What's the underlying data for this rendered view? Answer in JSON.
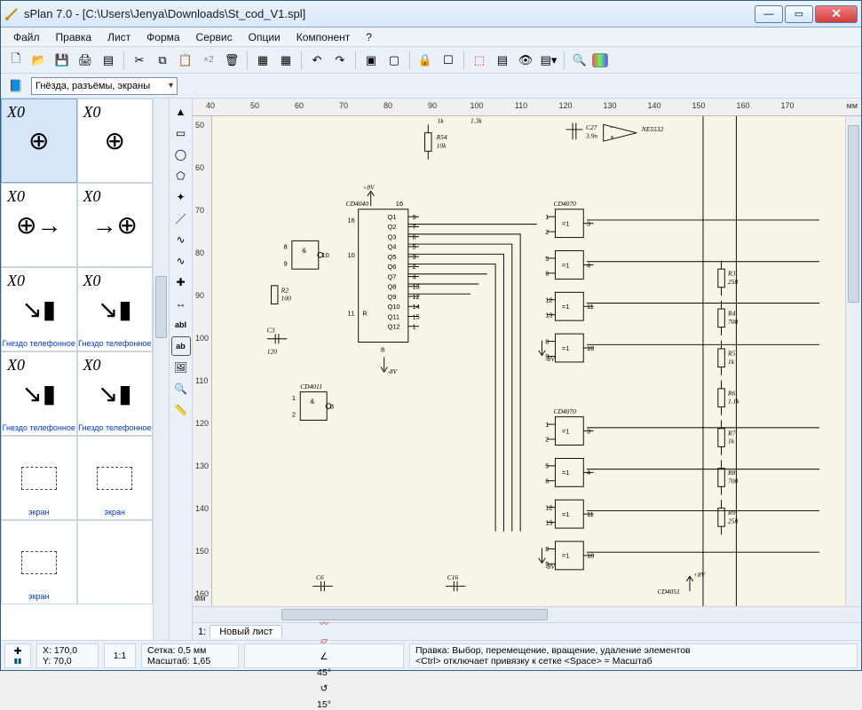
{
  "window": {
    "title": "sPlan 7.0 - [C:\\Users\\Jenya\\Downloads\\St_cod_V1.spl]"
  },
  "menu": [
    "Файл",
    "Правка",
    "Лист",
    "Форма",
    "Сервис",
    "Опции",
    "Компонент",
    "?"
  ],
  "library_combo": "Гнёзда, разъёмы, экраны",
  "palette": [
    {
      "id": "X0",
      "caption": ""
    },
    {
      "id": "X0",
      "caption": ""
    },
    {
      "id": "X0",
      "caption": ""
    },
    {
      "id": "X0",
      "caption": ""
    },
    {
      "id": "X0",
      "caption": "Гнездо телефонное"
    },
    {
      "id": "X0",
      "caption": "Гнездо телефонное"
    },
    {
      "id": "X0",
      "caption": "Гнездо телефонное"
    },
    {
      "id": "X0",
      "caption": "Гнездо телефонное"
    },
    {
      "id": "",
      "caption": "экран"
    },
    {
      "id": "",
      "caption": "экран"
    },
    {
      "id": "",
      "caption": "экран"
    },
    {
      "id": "",
      "caption": ""
    }
  ],
  "ruler": {
    "unit": "мм",
    "x": [
      40,
      50,
      60,
      70,
      80,
      90,
      100,
      110,
      120,
      130,
      140,
      150,
      160,
      170
    ],
    "y": [
      50,
      60,
      70,
      80,
      90,
      100,
      110,
      120,
      130,
      140,
      150,
      160
    ]
  },
  "tab": {
    "index": "1:",
    "name": "Новый лист"
  },
  "status": {
    "coord_x": "X: 170,0",
    "coord_y": "Y: 70,0",
    "ratio": "1:1",
    "grid": "Сетка: 0,5 мм",
    "scale": "Масштаб:  1,65",
    "angle1": "45°",
    "angle2": "15°",
    "hint1": "Правка: Выбор, перемещение, вращение, удаление элементов",
    "hint2": "<Ctrl> отключает привязку к сетке <Space> = Масштаб"
  },
  "schematic": {
    "ics": [
      {
        "ref": "CD4040",
        "pins_label": "16"
      },
      {
        "ref": "CD4011"
      },
      {
        "ref": "CD4070"
      },
      {
        "ref": "CD4070"
      },
      {
        "ref": "CD4051"
      }
    ],
    "gates": [
      {
        "sym": "&",
        "p_in": [
          "8",
          "9"
        ],
        "p_out": "10"
      },
      {
        "sym": "&",
        "p_in": [
          "1",
          "2"
        ],
        "p_out": "3"
      },
      {
        "sym": "=1",
        "p_in": [
          "1",
          "2"
        ],
        "p_out": "3"
      },
      {
        "sym": "=1",
        "p_in": [
          "5",
          "6"
        ],
        "p_out": "4"
      },
      {
        "sym": "=1",
        "p_in": [
          "12",
          "13"
        ],
        "p_out": "11"
      },
      {
        "sym": "=1",
        "p_in": [
          "8",
          "9"
        ],
        "p_out": "10"
      },
      {
        "sym": "=1",
        "p_in": [
          "1",
          "2"
        ],
        "p_out": "3"
      },
      {
        "sym": "=1",
        "p_in": [
          "5",
          "6"
        ],
        "p_out": "4"
      },
      {
        "sym": "=1",
        "p_in": [
          "12",
          "13"
        ],
        "p_out": "11"
      },
      {
        "sym": "=1",
        "p_in": [
          "8",
          "9"
        ],
        "p_out": "10"
      }
    ],
    "parts": [
      {
        "ref": "R54",
        "val": "10k"
      },
      {
        "ref": "C27",
        "val": "3.9n"
      },
      {
        "ref": "NE5532",
        "val": ""
      },
      {
        "ref": "R2",
        "val": "100"
      },
      {
        "ref": "C3",
        "val": "120"
      },
      {
        "ref": "R3",
        "val": "250"
      },
      {
        "ref": "R4",
        "val": "700"
      },
      {
        "ref": "R5",
        "val": "1k"
      },
      {
        "ref": "R6",
        "val": "1.1k"
      },
      {
        "ref": "R7",
        "val": "1k"
      },
      {
        "ref": "R8",
        "val": "700"
      },
      {
        "ref": "R9",
        "val": "250"
      },
      {
        "ref": "C6",
        "val": ""
      },
      {
        "ref": "C16",
        "val": ""
      }
    ],
    "nets": [
      "+8V",
      "-8V",
      "+8V",
      "-8V",
      "1k",
      "1.3k"
    ],
    "cd4040_pins": {
      "left": [
        {
          "n": "16"
        },
        {
          "n": "10"
        },
        {
          "n": "11",
          "lbl": "R"
        }
      ],
      "right": [
        {
          "n": "9",
          "lbl": "Q1"
        },
        {
          "n": "7",
          "lbl": "Q2"
        },
        {
          "n": "6",
          "lbl": "Q3"
        },
        {
          "n": "5",
          "lbl": "Q4"
        },
        {
          "n": "3",
          "lbl": "Q5"
        },
        {
          "n": "2",
          "lbl": "Q6"
        },
        {
          "n": "4",
          "lbl": "Q7"
        },
        {
          "n": "13",
          "lbl": "Q8"
        },
        {
          "n": "12",
          "lbl": "Q9"
        },
        {
          "n": "14",
          "lbl": "Q10"
        },
        {
          "n": "15",
          "lbl": "Q11"
        },
        {
          "n": "1",
          "lbl": "Q12"
        }
      ],
      "bottom": "8"
    }
  }
}
